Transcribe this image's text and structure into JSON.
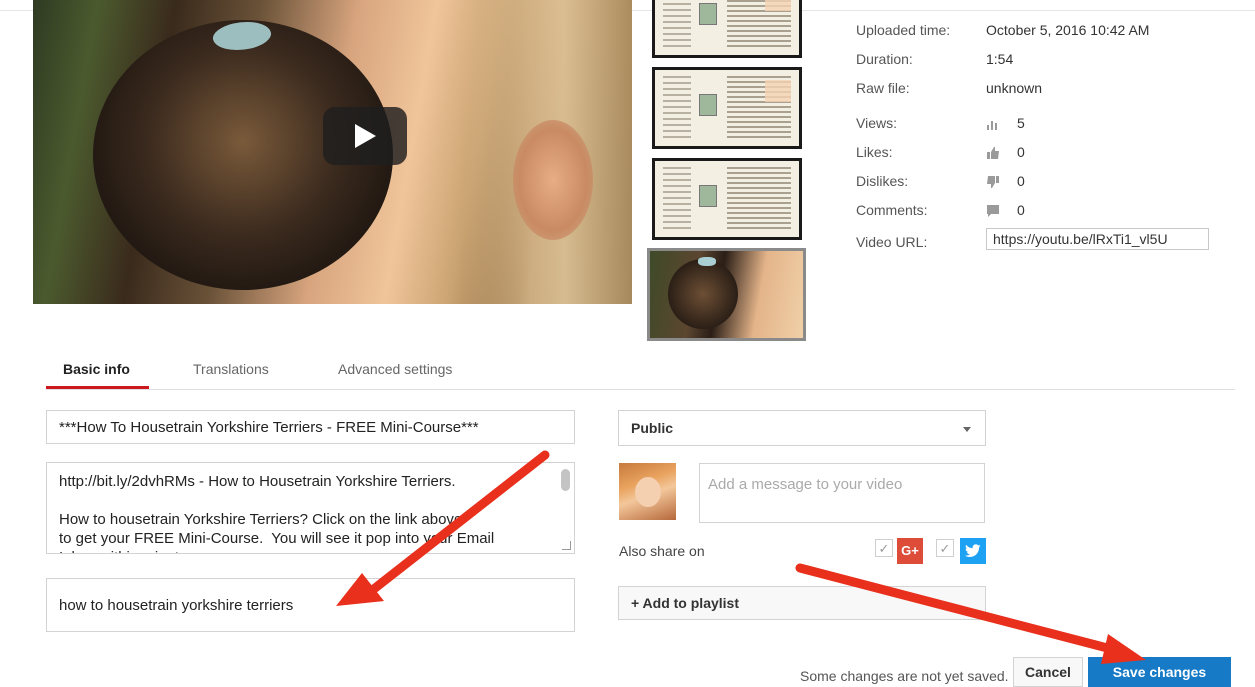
{
  "video": {
    "play_label": "Play"
  },
  "meta": {
    "uploaded_time_label": "Uploaded time:",
    "uploaded_time_value": "October 5, 2016 10:42 AM",
    "duration_label": "Duration:",
    "duration_value": "1:54",
    "raw_file_label": "Raw file:",
    "raw_file_value": "unknown",
    "views_label": "Views:",
    "views_value": "5",
    "likes_label": "Likes:",
    "likes_value": "0",
    "dislikes_label": "Dislikes:",
    "dislikes_value": "0",
    "comments_label": "Comments:",
    "comments_value": "0",
    "video_url_label": "Video URL:",
    "video_url_value": "https://youtu.be/lRxTi1_vl5U"
  },
  "tabs": [
    {
      "label": "Basic info",
      "active": true
    },
    {
      "label": "Translations",
      "active": false
    },
    {
      "label": "Advanced settings",
      "active": false
    }
  ],
  "form": {
    "title": "***How To Housetrain Yorkshire Terriers - FREE Mini-Course***",
    "description": "http://bit.ly/2dvhRMs - How to Housetrain Yorkshire Terriers.\n\nHow to housetrain Yorkshire Terriers? Click on the link above\nto get your FREE Mini-Course.  You will see it pop into your Email\nInbox within minutes.",
    "tags": "how to  housetrain yorkshire terriers",
    "privacy": "Public",
    "message_placeholder": "Add a message to your video",
    "also_share_label": "Also share on",
    "gplus_label": "G+",
    "add_playlist_label": "+ Add to playlist"
  },
  "footer": {
    "unsaved_message": "Some changes are not yet saved.",
    "cancel_label": "Cancel",
    "save_label": "Save changes"
  },
  "colors": {
    "save_button": "#167ac6",
    "active_tab_underline": "#cc181e",
    "gplus": "#dd4b39",
    "twitter": "#1da1f2",
    "annotation_arrow": "#e8301c"
  }
}
